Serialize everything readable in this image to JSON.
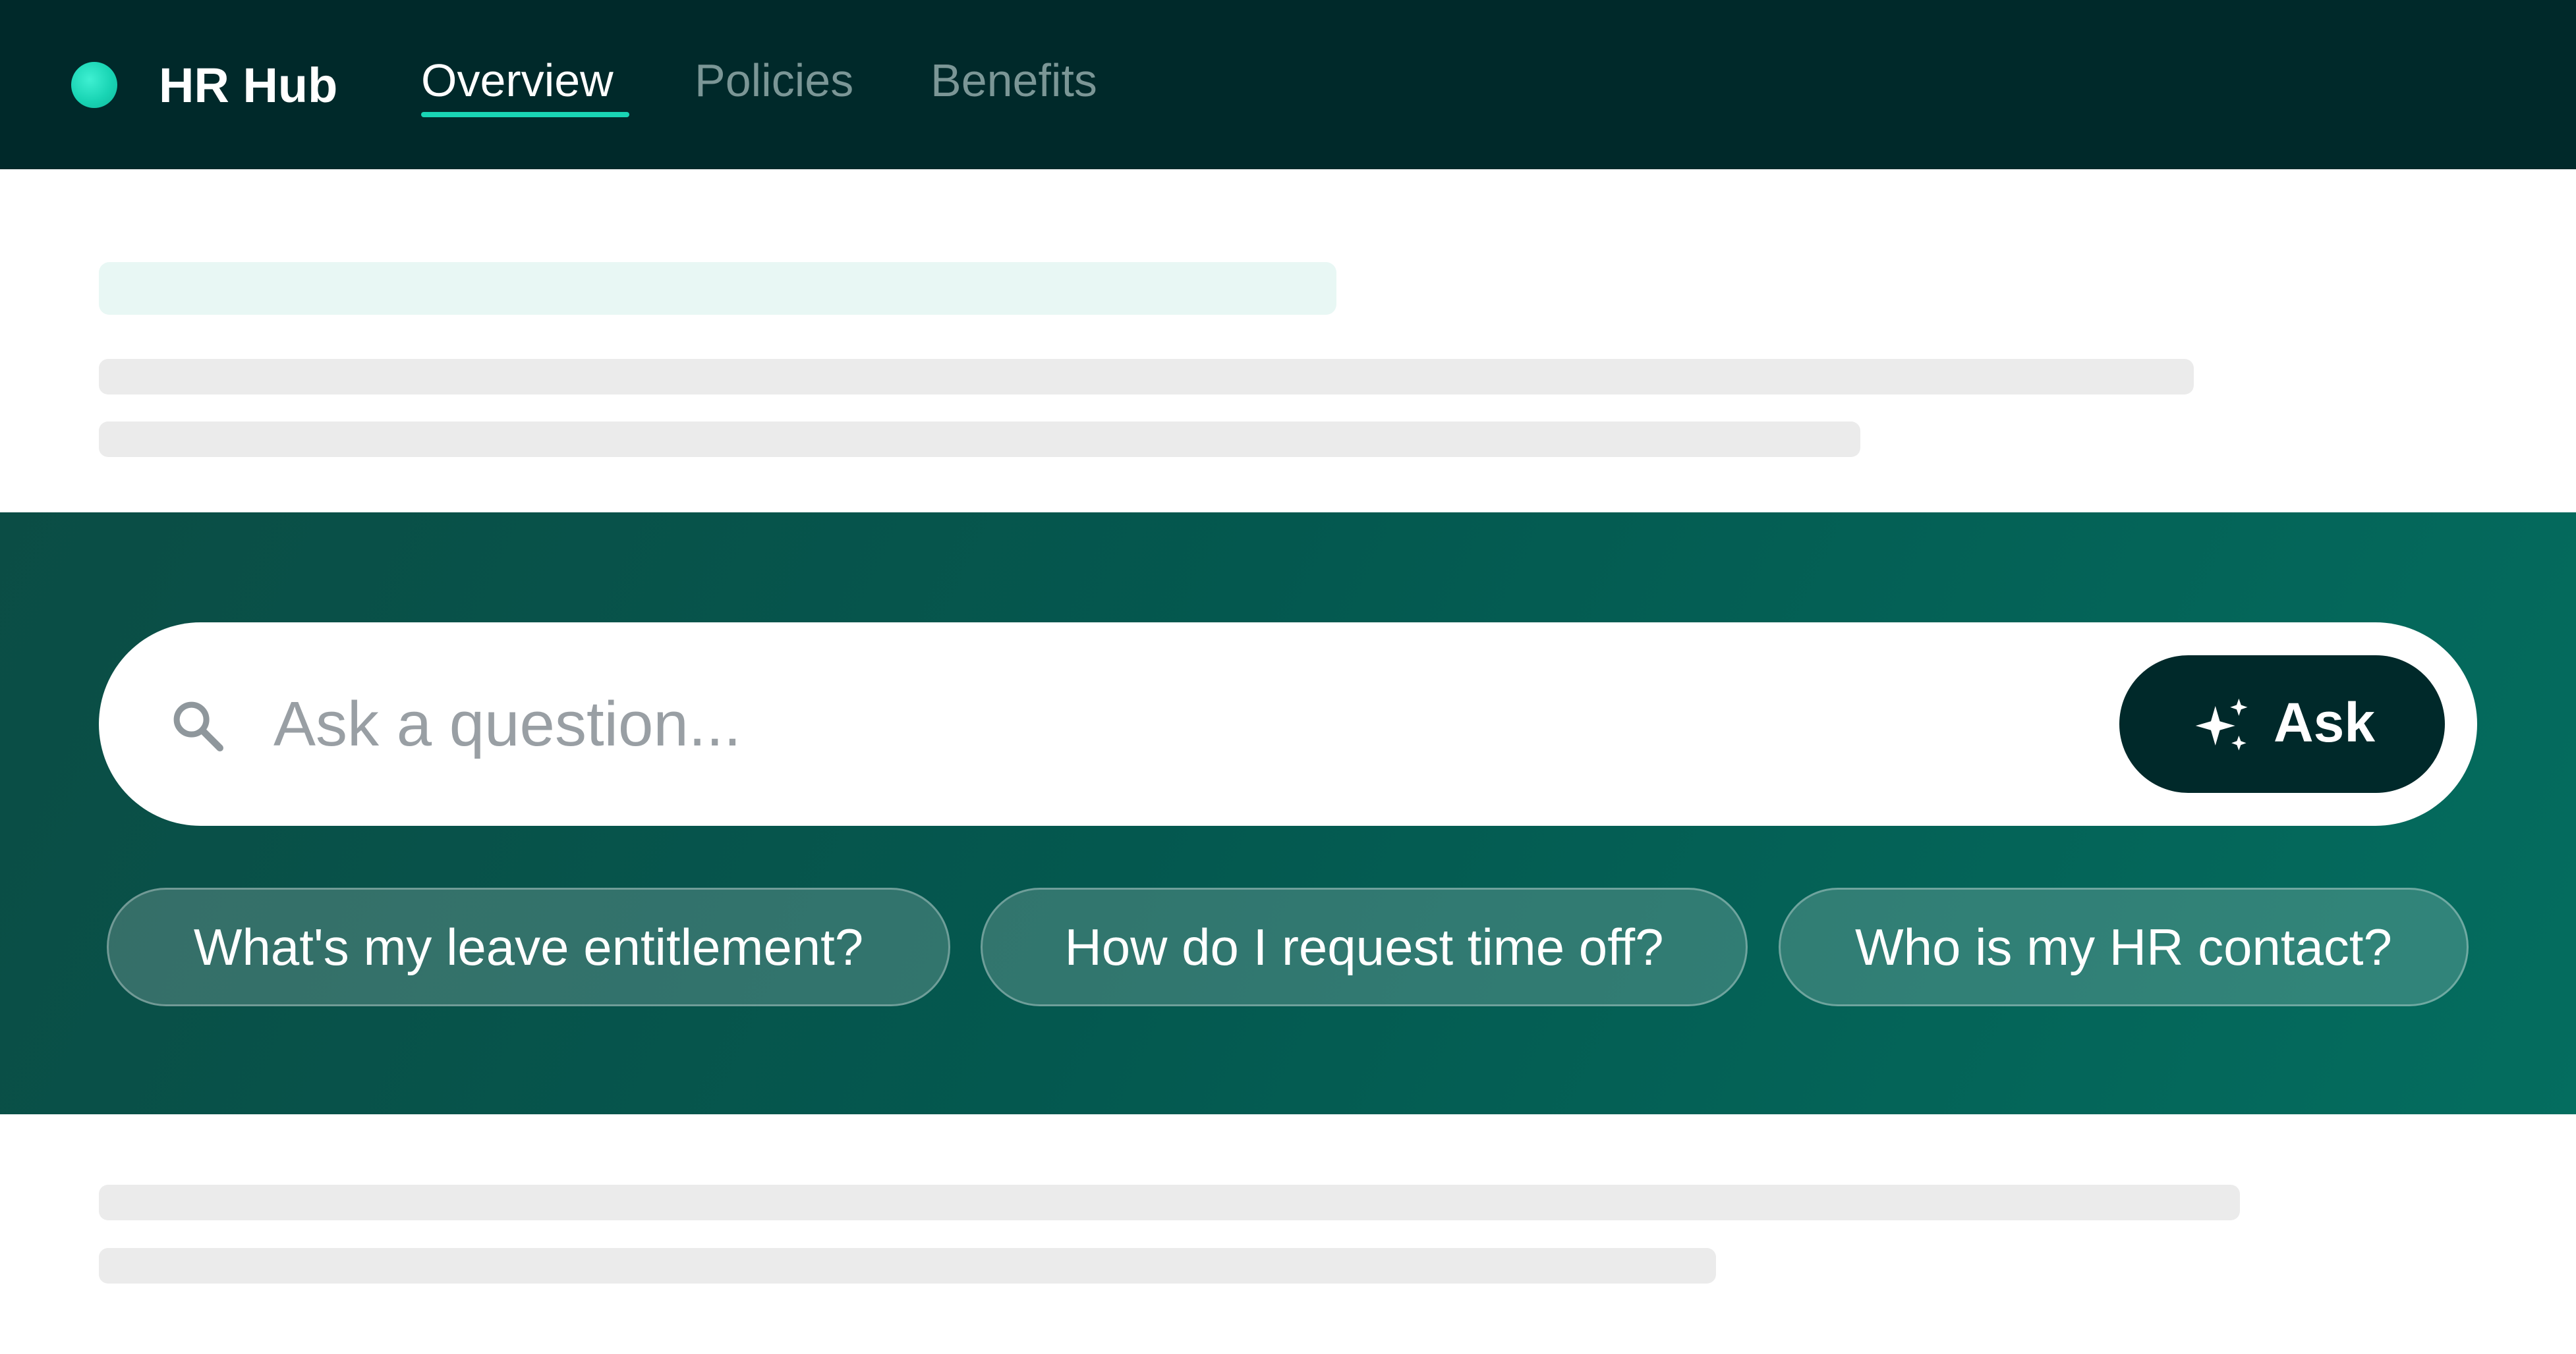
{
  "app": {
    "name": "HR Hub"
  },
  "nav": {
    "tabs": [
      {
        "label": "Overview",
        "active": true
      },
      {
        "label": "Policies",
        "active": false
      },
      {
        "label": "Benefits",
        "active": false
      }
    ]
  },
  "search": {
    "placeholder": "Ask a question...",
    "icon": "search-icon",
    "button_icon": "sparkle-icon",
    "button_label": "Ask"
  },
  "suggestions": [
    "What's my leave entitlement?",
    "How do I request time off?",
    "Who is my HR contact?"
  ],
  "colors": {
    "nav_background": "#00292a",
    "accent": "#19d4b4",
    "hero_gradient_start": "#0b4d45",
    "hero_gradient_end": "#046d5f",
    "skeleton": "#ebebeb",
    "skeleton_accent": "#e8f7f4"
  }
}
